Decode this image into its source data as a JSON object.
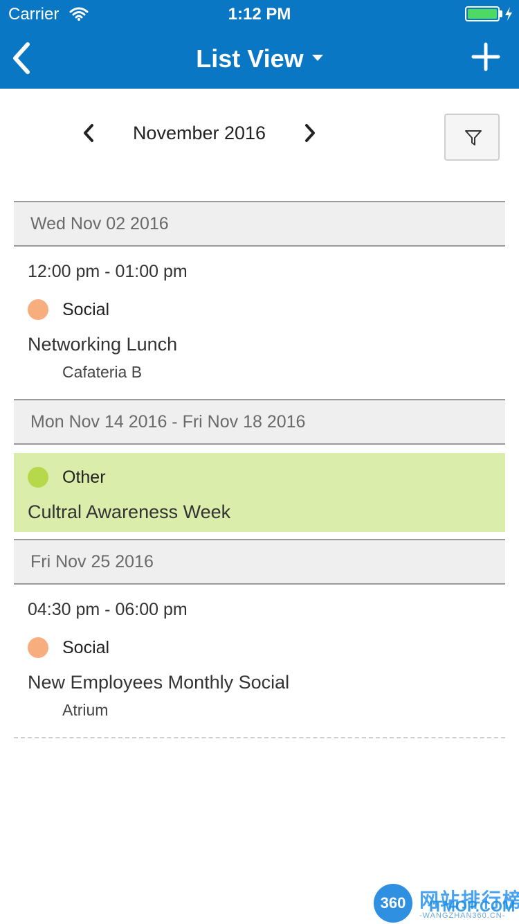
{
  "status_bar": {
    "carrier": "Carrier",
    "time": "1:12 PM",
    "battery_level": 1.0
  },
  "nav": {
    "title": "List View",
    "back_icon": "chevron-left-icon",
    "add_icon": "plus-icon",
    "title_caret_icon": "caret-down-icon"
  },
  "month_nav": {
    "label": "November 2016",
    "prev_icon": "chevron-left-icon",
    "next_icon": "chevron-right-icon",
    "filter_icon": "filter-icon"
  },
  "colors": {
    "header_bg": "#0a77c4",
    "social": "#f7ad7d",
    "other": "#b5d94a",
    "highlight_bg": "#dbedaa"
  },
  "groups": [
    {
      "date": "Wed Nov 02 2016",
      "events": [
        {
          "time": "12:00 pm - 01:00 pm",
          "category": "Social",
          "title": "Networking Lunch",
          "location": "Cafateria B"
        }
      ]
    },
    {
      "date": "Mon Nov 14 2016 - Fri Nov 18 2016",
      "events": [
        {
          "category": "Other",
          "title": "Cultral Awareness Week"
        }
      ]
    },
    {
      "date": "Fri Nov 25 2016",
      "events": [
        {
          "time": "04:30 pm - 06:00 pm",
          "category": "Social",
          "title": "New Employees Monthly Social",
          "location": "Atrium"
        }
      ]
    }
  ],
  "watermark": {
    "logo_text": "360",
    "name_cn": "网站排行榜",
    "site": "ITMOP.COM",
    "sub": "-WANGZHAN360.CN-"
  }
}
